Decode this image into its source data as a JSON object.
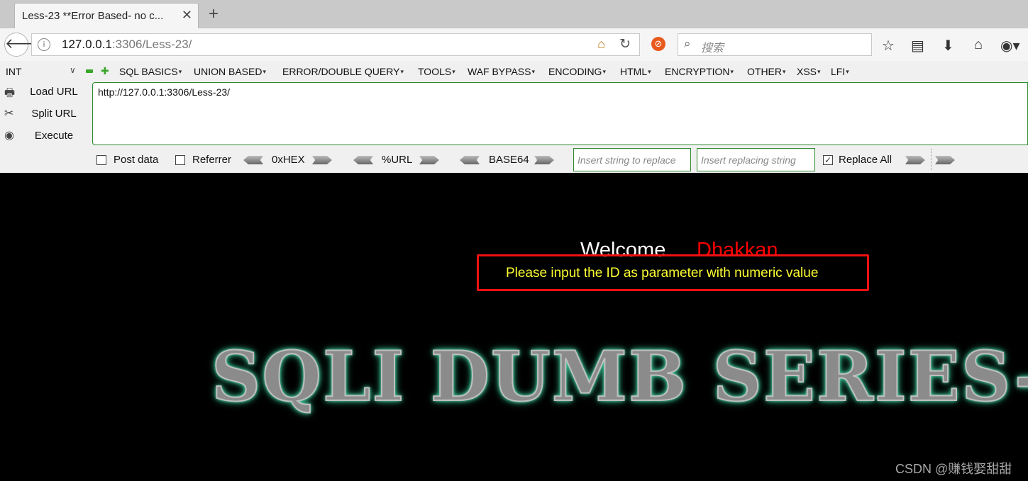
{
  "browser": {
    "tab_title": "Less-23 **Error Based- no c...",
    "tab_close": "✕",
    "new_tab": "+",
    "back": "🡐",
    "url_host": "127.0.0.1",
    "url_rest": ":3306/Less-23/",
    "search_placeholder": "搜索"
  },
  "hackbar": {
    "type_select": "INT",
    "menus": [
      "SQL BASICS",
      "UNION BASED",
      "ERROR/DOUBLE QUERY",
      "TOOLS",
      "WAF BYPASS",
      "ENCODING",
      "HTML",
      "ENCRYPTION",
      "OTHER",
      "XSS",
      "LFI"
    ],
    "actions": [
      "Load URL",
      "Split URL",
      "Execute"
    ],
    "url_value": "http://127.0.0.1:3306/Less-23/",
    "post_data": "Post data",
    "referrer": "Referrer",
    "encodings": [
      "0xHEX",
      "%URL",
      "BASE64"
    ],
    "insert_replace_placeholder": "Insert string to replace",
    "insert_replacing_placeholder": "Insert replacing string",
    "replace_all": "Replace All",
    "replace_all_checked": true
  },
  "page": {
    "welcome": "Welcome",
    "name": "Dhakkan",
    "message": "Please input the ID as parameter with numeric value",
    "banner": "SQLI DUMB SERIES-",
    "watermark": "CSDN @赚钱娶甜甜"
  },
  "colors": {
    "page_background": "#000000",
    "welcome": "#ffffff",
    "name": "#ff0000",
    "message": "#ffff33",
    "highlight_box": "#ee1111",
    "banner_glow": "#3fc898",
    "hackbar_border": "#2e8b2e"
  },
  "icons": {
    "back": "arrow-left-icon",
    "info": "info-icon",
    "home_in_url": "home-icon",
    "reload": "reload-icon",
    "noscript": "noscript-icon",
    "search": "search-icon",
    "bookmark": "star-icon",
    "reading_list": "list-icon",
    "download": "download-icon",
    "home": "home-icon",
    "account": "globe-icon"
  }
}
